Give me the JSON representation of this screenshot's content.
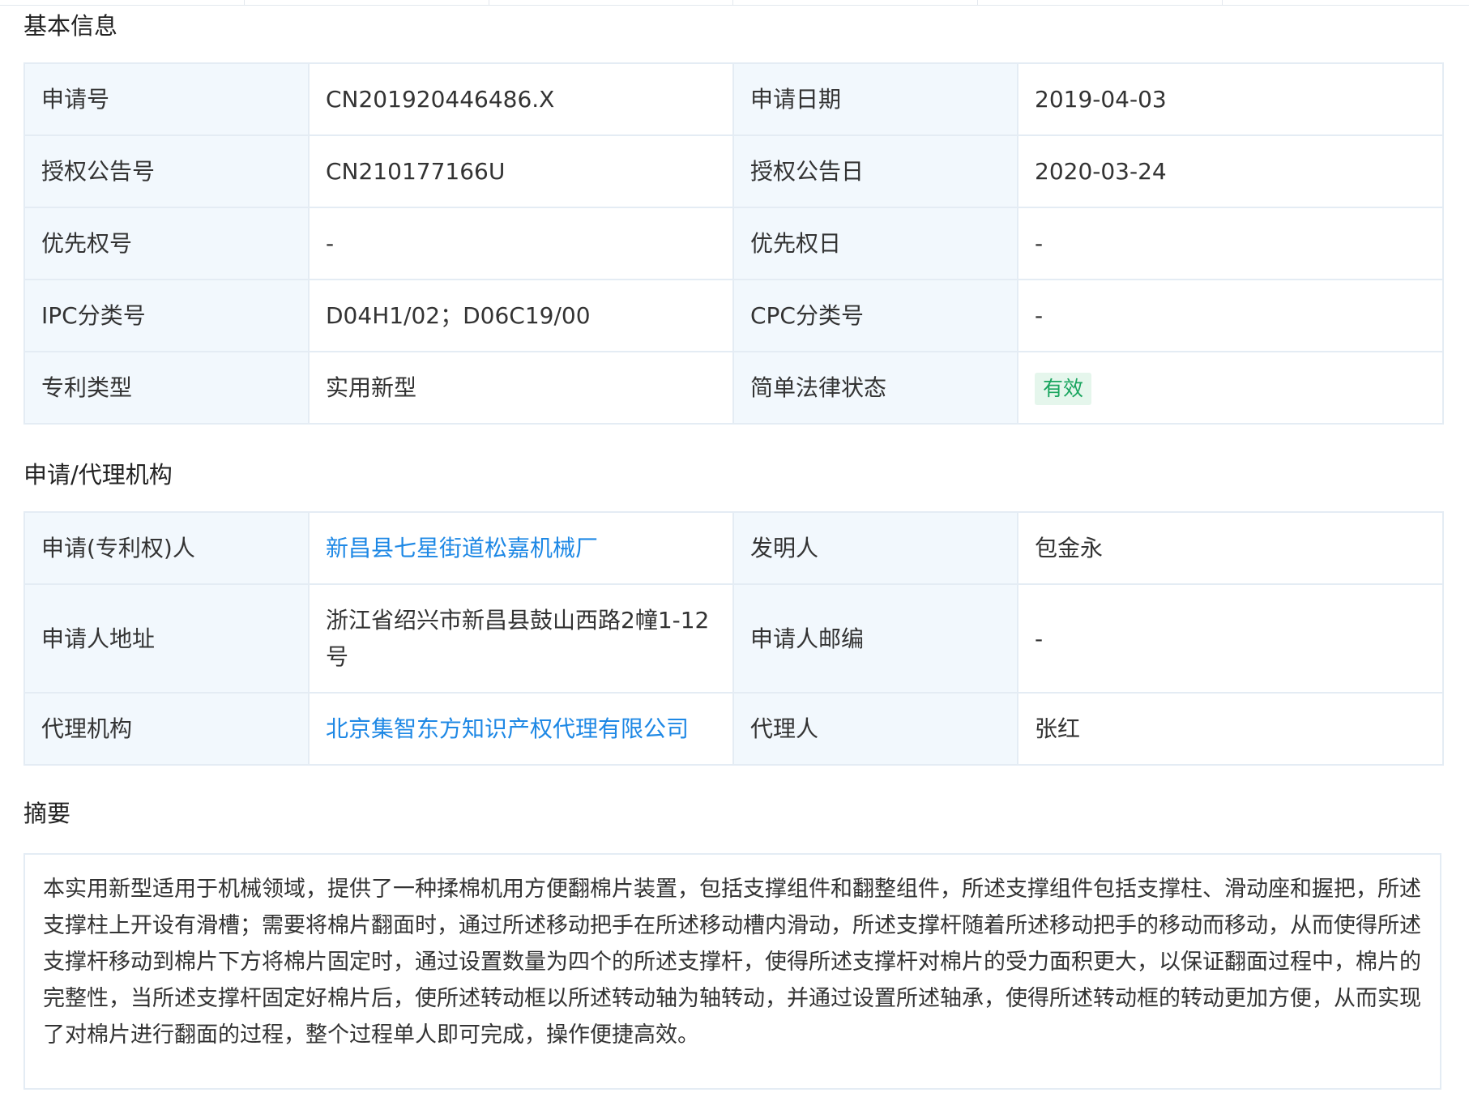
{
  "sections": {
    "basic_info_title": "基本信息",
    "agency_title": "申请/代理机构",
    "abstract_title": "摘要"
  },
  "basic_info": {
    "rows": [
      {
        "label1": "申请号",
        "value1": "CN201920446486.X",
        "label2": "申请日期",
        "value2": "2019-04-03"
      },
      {
        "label1": "授权公告号",
        "value1": "CN210177166U",
        "label2": "授权公告日",
        "value2": "2020-03-24"
      },
      {
        "label1": "优先权号",
        "value1": "-",
        "label2": "优先权日",
        "value2": "-"
      },
      {
        "label1": "IPC分类号",
        "value1": "D04H1/02；D06C19/00",
        "label2": "CPC分类号",
        "value2": "-"
      },
      {
        "label1": "专利类型",
        "value1": "实用新型",
        "label2": "简单法律状态",
        "value2": "有效"
      }
    ]
  },
  "agency": {
    "rows": [
      {
        "label1": "申请(专利权)人",
        "value1": "新昌县七星街道松嘉机械厂",
        "label2": "发明人",
        "value2": "包金永"
      },
      {
        "label1": "申请人地址",
        "value1": "浙江省绍兴市新昌县鼓山西路2幢1-12号",
        "label2": "申请人邮编",
        "value2": "-"
      },
      {
        "label1": "代理机构",
        "value1": "北京集智东方知识产权代理有限公司",
        "label2": "代理人",
        "value2": "张红"
      }
    ]
  },
  "abstract": {
    "text": "本实用新型适用于机械领域，提供了一种揉棉机用方便翻棉片装置，包括支撑组件和翻整组件，所述支撑组件包括支撑柱、滑动座和握把，所述支撑柱上开设有滑槽；需要将棉片翻面时，通过所述移动把手在所述移动槽内滑动，所述支撑杆随着所述移动把手的移动而移动，从而使得所述支撑杆移动到棉片下方将棉片固定时，通过设置数量为四个的所述支撑杆，使得所述支撑杆对棉片的受力面积更大，以保证翻面过程中，棉片的完整性，当所述支撑杆固定好棉片后，使所述转动框以所述转动轴为轴转动，并通过设置所述轴承，使得所述转动框的转动更加方便，从而实现了对棉片进行翻面的过程，整个过程单人即可完成，操作便捷高效。"
  },
  "colors": {
    "link": "#1e88e5",
    "label_bg": "#f2f8fd",
    "border": "#e4ecf4",
    "status_valid_bg": "#e5f6ec",
    "status_valid_text": "#1aa55f"
  }
}
